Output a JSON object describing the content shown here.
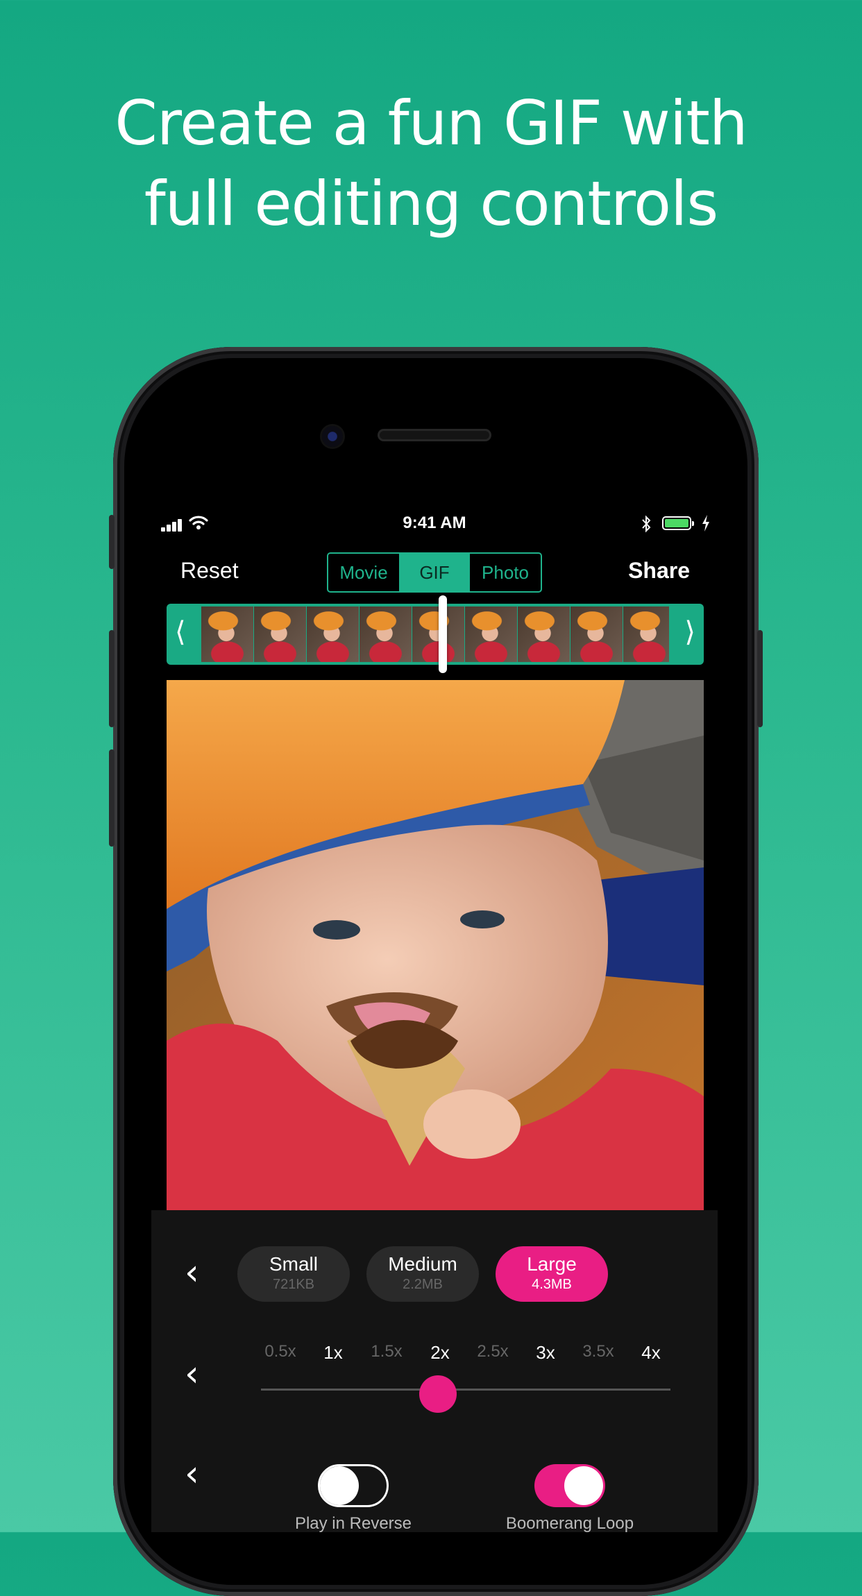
{
  "headline": {
    "line1": "Create a fun GIF with",
    "line2": "full editing controls"
  },
  "status_bar": {
    "time": "9:41 AM"
  },
  "toolbar": {
    "reset_label": "Reset",
    "share_label": "Share",
    "modes": [
      {
        "label": "Movie",
        "active": false
      },
      {
        "label": "GIF",
        "active": true
      },
      {
        "label": "Photo",
        "active": false
      }
    ]
  },
  "filmstrip": {
    "left_arrow": "⟨",
    "right_arrow": "⟩"
  },
  "size_options": {
    "back_icon": "‹",
    "items": [
      {
        "name": "Small",
        "size": "721KB",
        "selected": false
      },
      {
        "name": "Medium",
        "size": "2.2MB",
        "selected": false
      },
      {
        "name": "Large",
        "size": "4.3MB",
        "selected": true
      }
    ]
  },
  "speed": {
    "back_icon": "‹",
    "labels": [
      "0.5x",
      "1x",
      "1.5x",
      "2x",
      "2.5x",
      "3x",
      "3.5x",
      "4x"
    ],
    "selected": "2x"
  },
  "toggles": {
    "back_icon": "‹",
    "play_in_reverse": {
      "label": "Play in Reverse",
      "on": false
    },
    "boomerang_loop": {
      "label": "Boomerang Loop",
      "on": true
    }
  },
  "colors": {
    "accent_green": "#1fb38c",
    "accent_pink": "#e91e84"
  }
}
